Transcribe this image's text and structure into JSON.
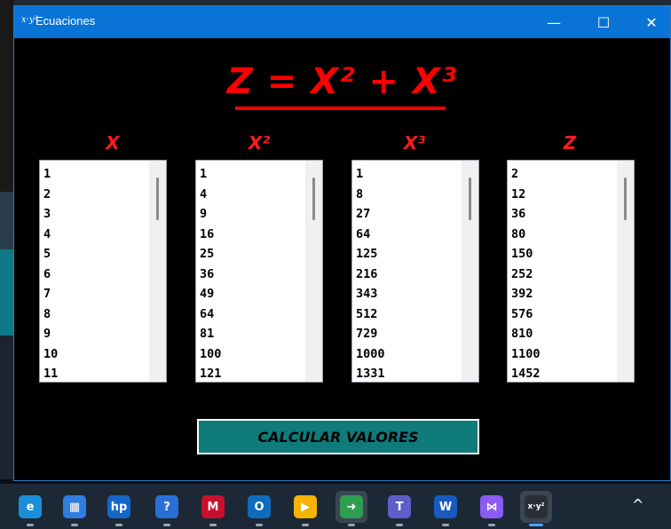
{
  "window": {
    "title": "Ecuaciones",
    "app_icon_text": "x·y²",
    "controls": {
      "minimize": "—",
      "maximize": "☐",
      "close": "✕"
    }
  },
  "formula": {
    "text": "Z = X² + X³"
  },
  "columns": [
    {
      "header": "X",
      "values": [
        "1",
        "2",
        "3",
        "4",
        "5",
        "6",
        "7",
        "8",
        "9",
        "10",
        "11"
      ]
    },
    {
      "header": "X²",
      "values": [
        "1",
        "4",
        "9",
        "16",
        "25",
        "36",
        "49",
        "64",
        "81",
        "100",
        "121"
      ]
    },
    {
      "header": "X³",
      "values": [
        "1",
        "8",
        "27",
        "64",
        "125",
        "216",
        "343",
        "512",
        "729",
        "1000",
        "1331"
      ]
    },
    {
      "header": "Z",
      "values": [
        "2",
        "12",
        "36",
        "80",
        "150",
        "252",
        "392",
        "576",
        "810",
        "1100",
        "1452"
      ]
    }
  ],
  "calculate_button": {
    "label": "CALCULAR VALORES"
  },
  "taskbar": {
    "items": [
      {
        "name": "edge-icon",
        "glyph": "e",
        "color": "#1a8fd8"
      },
      {
        "name": "store-icon",
        "glyph": "▦",
        "color": "#2f7de1"
      },
      {
        "name": "myhp-icon",
        "glyph": "hp",
        "color": "#1466c8"
      },
      {
        "name": "help-icon",
        "glyph": "?",
        "color": "#2b6fd6"
      },
      {
        "name": "mcafee-icon",
        "glyph": "M",
        "color": "#c8102e"
      },
      {
        "name": "outlook-icon",
        "glyph": "O",
        "color": "#0f6cbd"
      },
      {
        "name": "slides-icon",
        "glyph": "▶",
        "color": "#f4b400"
      },
      {
        "name": "app-arrow-icon",
        "glyph": "➜",
        "color": "#2e9e4f"
      },
      {
        "name": "teams-icon",
        "glyph": "T",
        "color": "#5b5fc7"
      },
      {
        "name": "word-icon",
        "glyph": "W",
        "color": "#185abd"
      },
      {
        "name": "visual-studio-icon",
        "glyph": "⋈",
        "color": "#8a5cf5"
      },
      {
        "name": "ecuaciones-app-icon",
        "glyph": "x·y²",
        "color": "#2a2f36"
      }
    ],
    "tray_chevron": "^"
  },
  "colors": {
    "titlebar": "#0a74d6",
    "formula": "#ff0000",
    "button": "#0f7b7b",
    "window_bg": "#000000"
  }
}
